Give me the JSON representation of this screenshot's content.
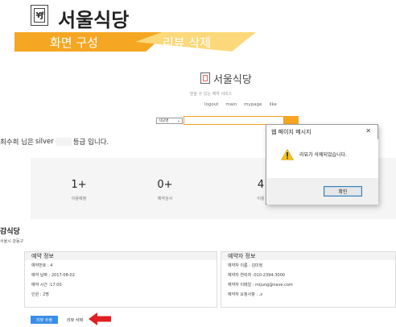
{
  "slide": {
    "title": "서울식당",
    "tabs": [
      {
        "label": "화면 구성"
      },
      {
        "label": "리뷰 삭제"
      }
    ]
  },
  "site": {
    "title": "서울식당",
    "subtitle": "믿을 수 있는 예약 서비스",
    "nav": [
      "logout",
      "main",
      "mypage",
      "like"
    ]
  },
  "search": {
    "select_value": "식당명",
    "input_value": ""
  },
  "greeting": {
    "prefix": "최수희 님은",
    "grade": "silver",
    "suffix": "등급 입니다."
  },
  "stats": [
    {
      "value": "1+",
      "label": "이용예정"
    },
    {
      "value": "0+",
      "label": "예약심사"
    },
    {
      "value": "4",
      "label": "이용"
    }
  ],
  "restaurant": {
    "name": "감식당",
    "address": "서울시 강동구"
  },
  "reservation_info": {
    "heading": "예약 정보",
    "rows": [
      "예약번호 : 4",
      "예약 날짜 : 2017-08-02",
      "예약 시간 :17:00",
      "인원 : 2명"
    ]
  },
  "reserver_info": {
    "heading": "예약자 정보",
    "rows": [
      "예약자 이름 : 김미정",
      "예약자 연락처 :010-2394-3000",
      "예약자 이메일 : mijung@nave.com",
      "예약자 요청사항 : ,x"
    ]
  },
  "buttons": {
    "edit_review": "리뷰 수정",
    "delete_review": "리뷰 삭제"
  },
  "dialog": {
    "title": "웹 페이지 메시지",
    "close": "✕",
    "message": "리뷰가 삭제되었습니다.",
    "ok": "확인"
  },
  "colors": {
    "ribbon_primary": "#f5a623",
    "ribbon_secondary": "#fbd87a",
    "primary_button": "#3a8ee6",
    "arrow": "#e02020"
  }
}
